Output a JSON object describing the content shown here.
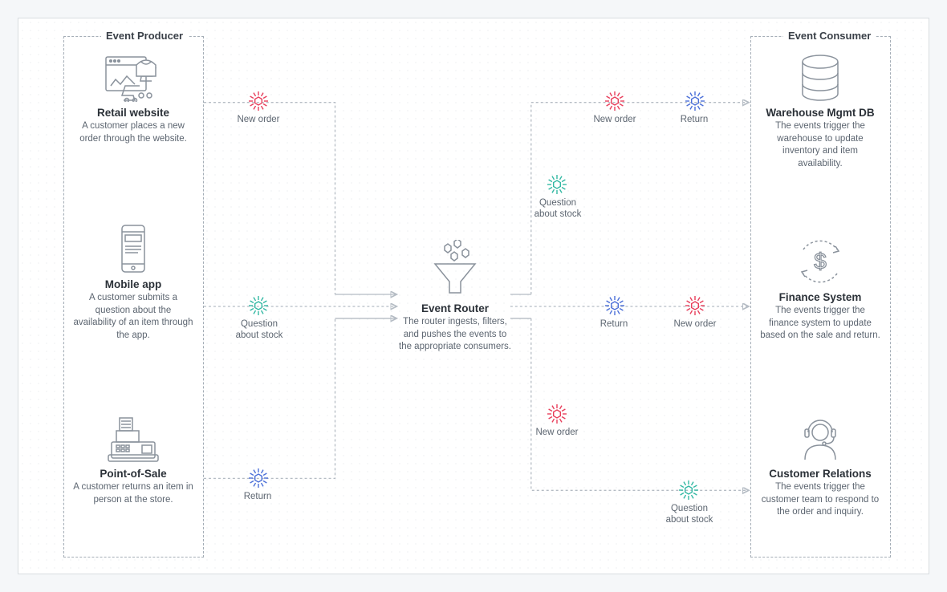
{
  "groups": {
    "producer": {
      "label": "Event Producer"
    },
    "consumer": {
      "label": "Event Consumer"
    }
  },
  "producers": {
    "retail": {
      "title": "Retail website",
      "desc": "A customer places a new order through the website."
    },
    "mobile": {
      "title": "Mobile app",
      "desc": "A customer submits a question about the availability of an item through the app."
    },
    "pos": {
      "title": "Point-of-Sale",
      "desc": "A customer returns an item in person at the store."
    }
  },
  "router": {
    "title": "Event Router",
    "desc": "The router ingests, filters, and pushes the events to the appropriate consumers."
  },
  "consumers": {
    "warehouse": {
      "title": "Warehouse Mgmt DB",
      "desc": "The events trigger the warehouse to update inventory and item availability."
    },
    "finance": {
      "title": "Finance System",
      "desc": "The events trigger the finance system to update based on the sale and return."
    },
    "crm": {
      "title": "Customer Relations",
      "desc": "The events trigger the customer team to respond to the order and inquiry."
    }
  },
  "events": {
    "new_order": "New order",
    "question_stock": "Question about stock",
    "question_stock_l1": "Question",
    "question_stock_l2": "about stock",
    "return": "Return"
  },
  "colors": {
    "new_order": "#e83e5b",
    "question_stock": "#32b8a3",
    "return": "#4b6fd8",
    "line": "#b5bcc4"
  }
}
